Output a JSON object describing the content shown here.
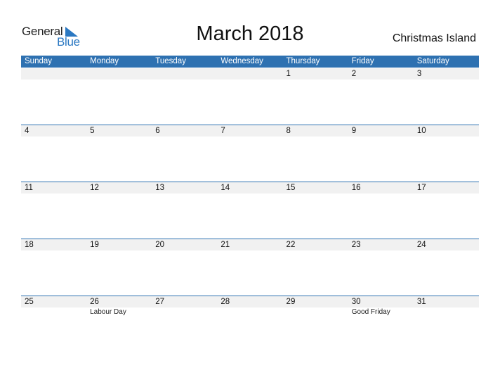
{
  "logo": {
    "word1": "General",
    "word2": "Blue"
  },
  "title": "March 2018",
  "region": "Christmas Island",
  "colors": {
    "accent": "#2e71b1",
    "strip": "#f1f1f1"
  },
  "weekdays": [
    "Sunday",
    "Monday",
    "Tuesday",
    "Wednesday",
    "Thursday",
    "Friday",
    "Saturday"
  ],
  "weeks": [
    [
      {
        "d": ""
      },
      {
        "d": ""
      },
      {
        "d": ""
      },
      {
        "d": ""
      },
      {
        "d": "1"
      },
      {
        "d": "2"
      },
      {
        "d": "3"
      }
    ],
    [
      {
        "d": "4"
      },
      {
        "d": "5"
      },
      {
        "d": "6"
      },
      {
        "d": "7"
      },
      {
        "d": "8"
      },
      {
        "d": "9"
      },
      {
        "d": "10"
      }
    ],
    [
      {
        "d": "11"
      },
      {
        "d": "12"
      },
      {
        "d": "13"
      },
      {
        "d": "14"
      },
      {
        "d": "15"
      },
      {
        "d": "16"
      },
      {
        "d": "17"
      }
    ],
    [
      {
        "d": "18"
      },
      {
        "d": "19"
      },
      {
        "d": "20"
      },
      {
        "d": "21"
      },
      {
        "d": "22"
      },
      {
        "d": "23"
      },
      {
        "d": "24"
      }
    ],
    [
      {
        "d": "25"
      },
      {
        "d": "26",
        "h": "Labour Day"
      },
      {
        "d": "27"
      },
      {
        "d": "28"
      },
      {
        "d": "29"
      },
      {
        "d": "30",
        "h": "Good Friday"
      },
      {
        "d": "31"
      }
    ]
  ]
}
